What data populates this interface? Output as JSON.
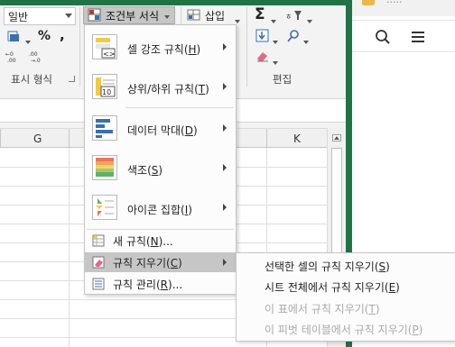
{
  "ribbon": {
    "number_format_value": "일반",
    "percent_symbol": "%",
    "comma_symbol": ",",
    "number_group_label": "표시 형식",
    "cf_button_label": "조건부 서식",
    "insert_label": "삽입",
    "sum_symbol": "Σ",
    "edit_group_label": "편집"
  },
  "grid": {
    "column_letters": [
      "G",
      "K"
    ]
  },
  "cf_menu": {
    "items": [
      {
        "label": "셀 강조 규칙(",
        "key": "H",
        "suffix": ")"
      },
      {
        "label": "상위/하위 규칙(",
        "key": "T",
        "suffix": ")"
      },
      {
        "label": "데이터 막대(",
        "key": "D",
        "suffix": ")"
      },
      {
        "label": "색조(",
        "key": "S",
        "suffix": ")"
      },
      {
        "label": "아이콘 집합(",
        "key": "I",
        "suffix": ")"
      },
      {
        "label": "새 규칙(",
        "key": "N",
        "suffix": ")..."
      },
      {
        "label": "규칙 지우기(",
        "key": "C",
        "suffix": ")"
      },
      {
        "label": "규칙 관리(",
        "key": "R",
        "suffix": ")..."
      }
    ],
    "icon_numbers": {
      "top_bottom": "10"
    },
    "cell_rule_symbol": "<>"
  },
  "clear_submenu": {
    "items": [
      {
        "label": "선택한 셀의 규칙 지우기(",
        "key": "S",
        "suffix": ")",
        "enabled": true
      },
      {
        "label": "시트 전체에서 규칙 지우기(",
        "key": "E",
        "suffix": ")",
        "enabled": true
      },
      {
        "label": "이 표에서 규칙 지우기(",
        "key": "T",
        "suffix": ")",
        "enabled": false
      },
      {
        "label": "이 피벗 테이블에서 규칙 지우기(",
        "key": "P",
        "suffix": ")",
        "enabled": false
      }
    ]
  },
  "right_pane": {
    "partial_text": "·····"
  },
  "colors": {
    "excel_green": "#217346",
    "highlight": "#c6c6c6",
    "disabled_text": "#a9a9a9"
  }
}
